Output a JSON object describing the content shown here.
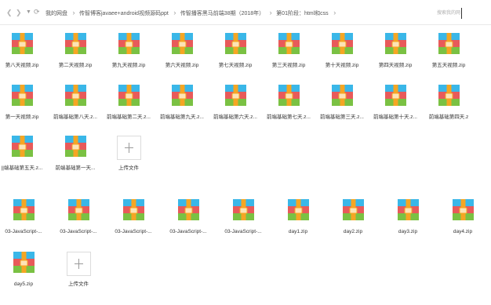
{
  "nav": {
    "back_icon": "chevron-left-icon",
    "forward_icon": "chevron-right-icon",
    "menu_icon": "caret-down-icon",
    "refresh_icon": "refresh-icon"
  },
  "breadcrumb": [
    "我的网盘",
    "传智博客javaee+android视频源码ppt",
    "传智播客黑马前端38期（2018年）",
    "第01阶段：html和css"
  ],
  "search": {
    "placeholder": "搜索我的网"
  },
  "colors": {
    "zip_top": "#3ab7e8",
    "zip_mid": "#e85a5a",
    "zip_bottom": "#7ac143",
    "zip_strap": "#f5a623",
    "zip_tag": "#fde4b6"
  },
  "section1": {
    "rows": [
      [
        "第八天视频.zip",
        "第二天视频.zip",
        "第九天视频.zip",
        "第六天视频.zip",
        "第七天视频.zip",
        "第三天视频.zip",
        "第十天视频.zip",
        "第四天视频.zip",
        "第五天视频.zip"
      ],
      [
        "第一天视频.zip",
        "前端基础第八天.z...",
        "前端基础第二天.z...",
        "前端基础第九天.z...",
        "前端基础第六天.z...",
        "前端基础第七天.z...",
        "前端基础第三天.z...",
        "前端基础第十天.z...",
        "前端基础第四天.z"
      ],
      [
        "||端基础第五天.z...",
        "前端基础第一天..."
      ]
    ],
    "upload_label": "上传文件"
  },
  "section2": {
    "row1": [
      "03-JavaScript-...",
      "03-JavaScript-...",
      "03-JavaScript-...",
      "03-JavaScript-...",
      "03-JavaScript-...",
      "day1.zip",
      "day2.zip",
      "day3.zip",
      "day4.zip"
    ],
    "row2": [
      "day5.zip"
    ],
    "upload_label": "上传文件"
  }
}
